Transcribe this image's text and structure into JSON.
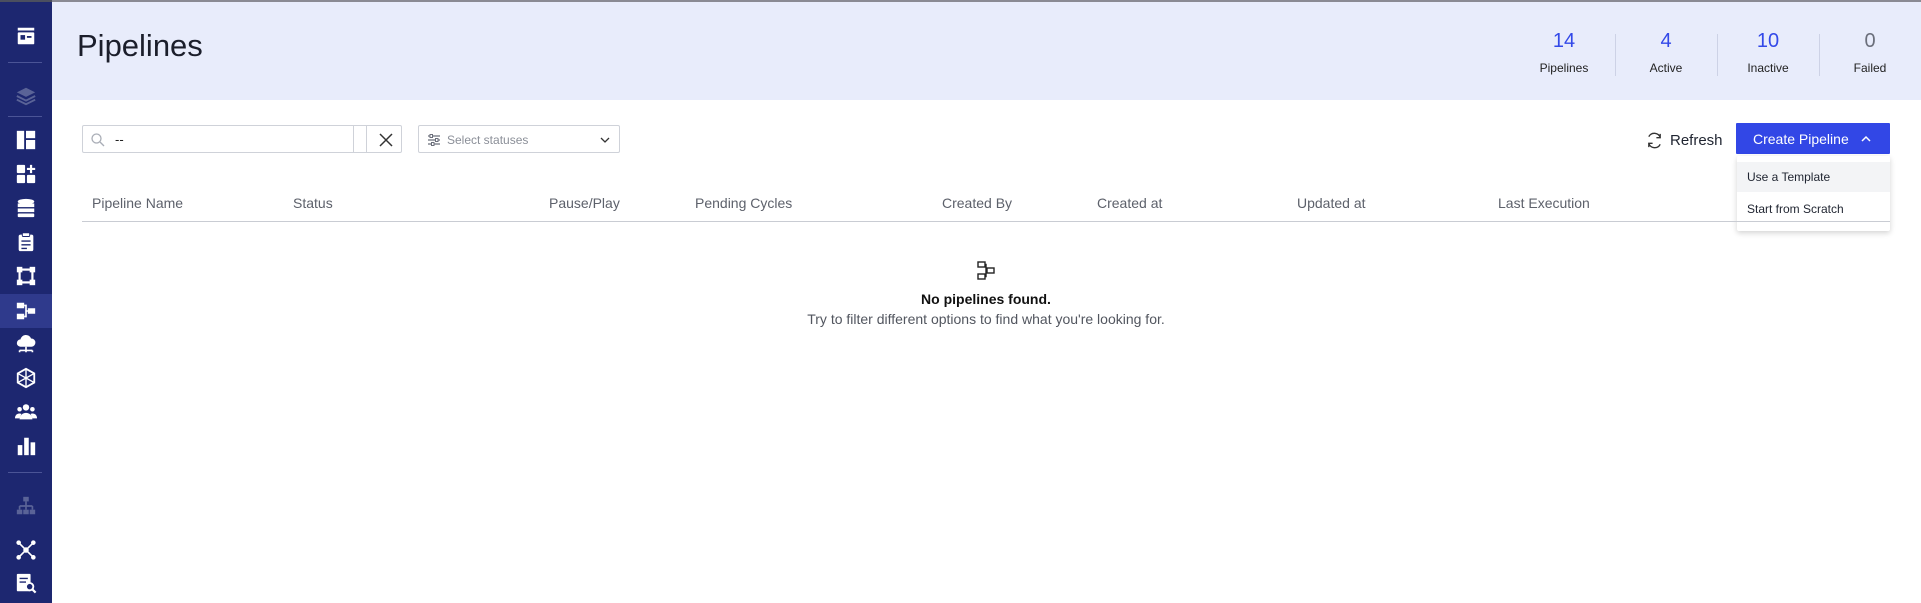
{
  "header": {
    "title": "Pipelines",
    "stats": [
      {
        "value": "14",
        "label": "Pipelines"
      },
      {
        "value": "4",
        "label": "Active"
      },
      {
        "value": "10",
        "label": "Inactive"
      },
      {
        "value": "0",
        "label": "Failed"
      }
    ]
  },
  "toolbar": {
    "search_value": "--",
    "status_placeholder": "Select statuses",
    "refresh_label": "Refresh",
    "create_label": "Create Pipeline",
    "create_menu": [
      "Use a Template",
      "Start from Scratch"
    ]
  },
  "table": {
    "columns": [
      "Pipeline Name",
      "Status",
      "Pause/Play",
      "Pending Cycles",
      "Created By",
      "Created at",
      "Updated at",
      "Last Execution"
    ]
  },
  "empty_state": {
    "title": "No pipelines found.",
    "subtitle": "Try to filter different options to find what you're looking for."
  },
  "colors": {
    "sidebar": "#1d2770",
    "header_band": "#e8ecfb",
    "accent": "#3247e6"
  },
  "sidebar_icons": [
    "app-logo-icon",
    "layers-icon",
    "dashboard-icon",
    "add-widget-icon",
    "database-icon",
    "clipboard-icon",
    "frame-icon",
    "pipeline-icon",
    "cloud-network-icon",
    "network-icon",
    "users-icon",
    "bar-chart-icon",
    "hierarchy-icon",
    "graph-icon",
    "search-document-icon"
  ]
}
